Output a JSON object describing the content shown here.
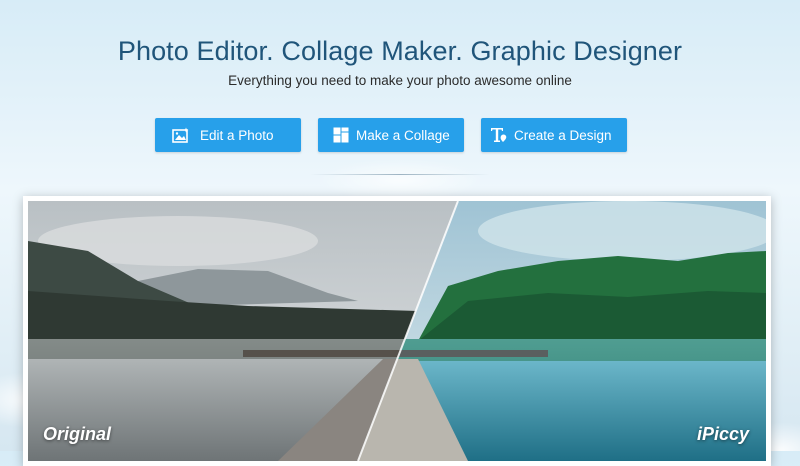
{
  "hero": {
    "title": "Photo Editor. Collage Maker. Graphic Designer",
    "subtitle": "Everything you need to make your photo awesome online"
  },
  "actions": [
    {
      "label": "Edit a Photo",
      "icon": "photo-edit-icon"
    },
    {
      "label": "Make a Collage",
      "icon": "collage-grid-icon"
    },
    {
      "label": "Create a Design",
      "icon": "design-text-icon"
    }
  ],
  "showcase": {
    "before_label": "Original",
    "after_label": "iPiccy"
  },
  "colors": {
    "title": "#20557a",
    "button": "#27a0ea"
  }
}
